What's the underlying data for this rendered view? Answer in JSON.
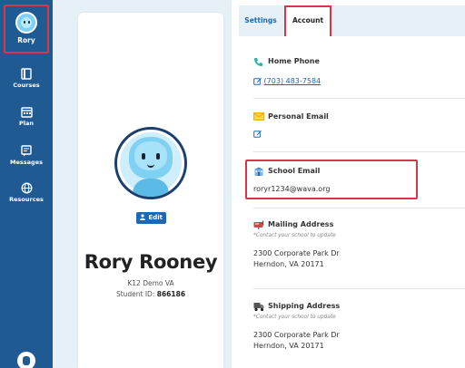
{
  "sidebar": {
    "user_short_name": "Rory",
    "items": [
      {
        "label": "Courses",
        "icon": "book-icon"
      },
      {
        "label": "Plan",
        "icon": "calendar-icon"
      },
      {
        "label": "Messages",
        "icon": "message-icon"
      },
      {
        "label": "Resources",
        "icon": "globe-icon"
      }
    ]
  },
  "profile": {
    "edit_label": "Edit",
    "full_name": "Rory Rooney",
    "school": "K12 Demo VA",
    "student_id_label": "Student ID:",
    "student_id": "866186"
  },
  "tabs": [
    {
      "label": "Settings",
      "active": false
    },
    {
      "label": "Account",
      "active": true
    }
  ],
  "account": {
    "home_phone": {
      "label": "Home Phone",
      "value": "(703) 483-7584"
    },
    "personal_email": {
      "label": "Personal Email",
      "value": ""
    },
    "school_email": {
      "label": "School Email",
      "value": "roryr1234@wava.org"
    },
    "mailing_address": {
      "label": "Mailing Address",
      "note": "*Contact your school to update",
      "line1": "2300 Corporate Park Dr",
      "line2": "Herndon, VA 20171"
    },
    "shipping_address": {
      "label": "Shipping Address",
      "note": "*Contact your school to update",
      "line1": "2300 Corporate Park Dr",
      "line2": "Herndon, VA 20171"
    }
  },
  "colors": {
    "sidebar": "#1f5a92",
    "accent": "#1f67b1",
    "highlight": "#d8344a",
    "background": "#e6f0f7"
  }
}
